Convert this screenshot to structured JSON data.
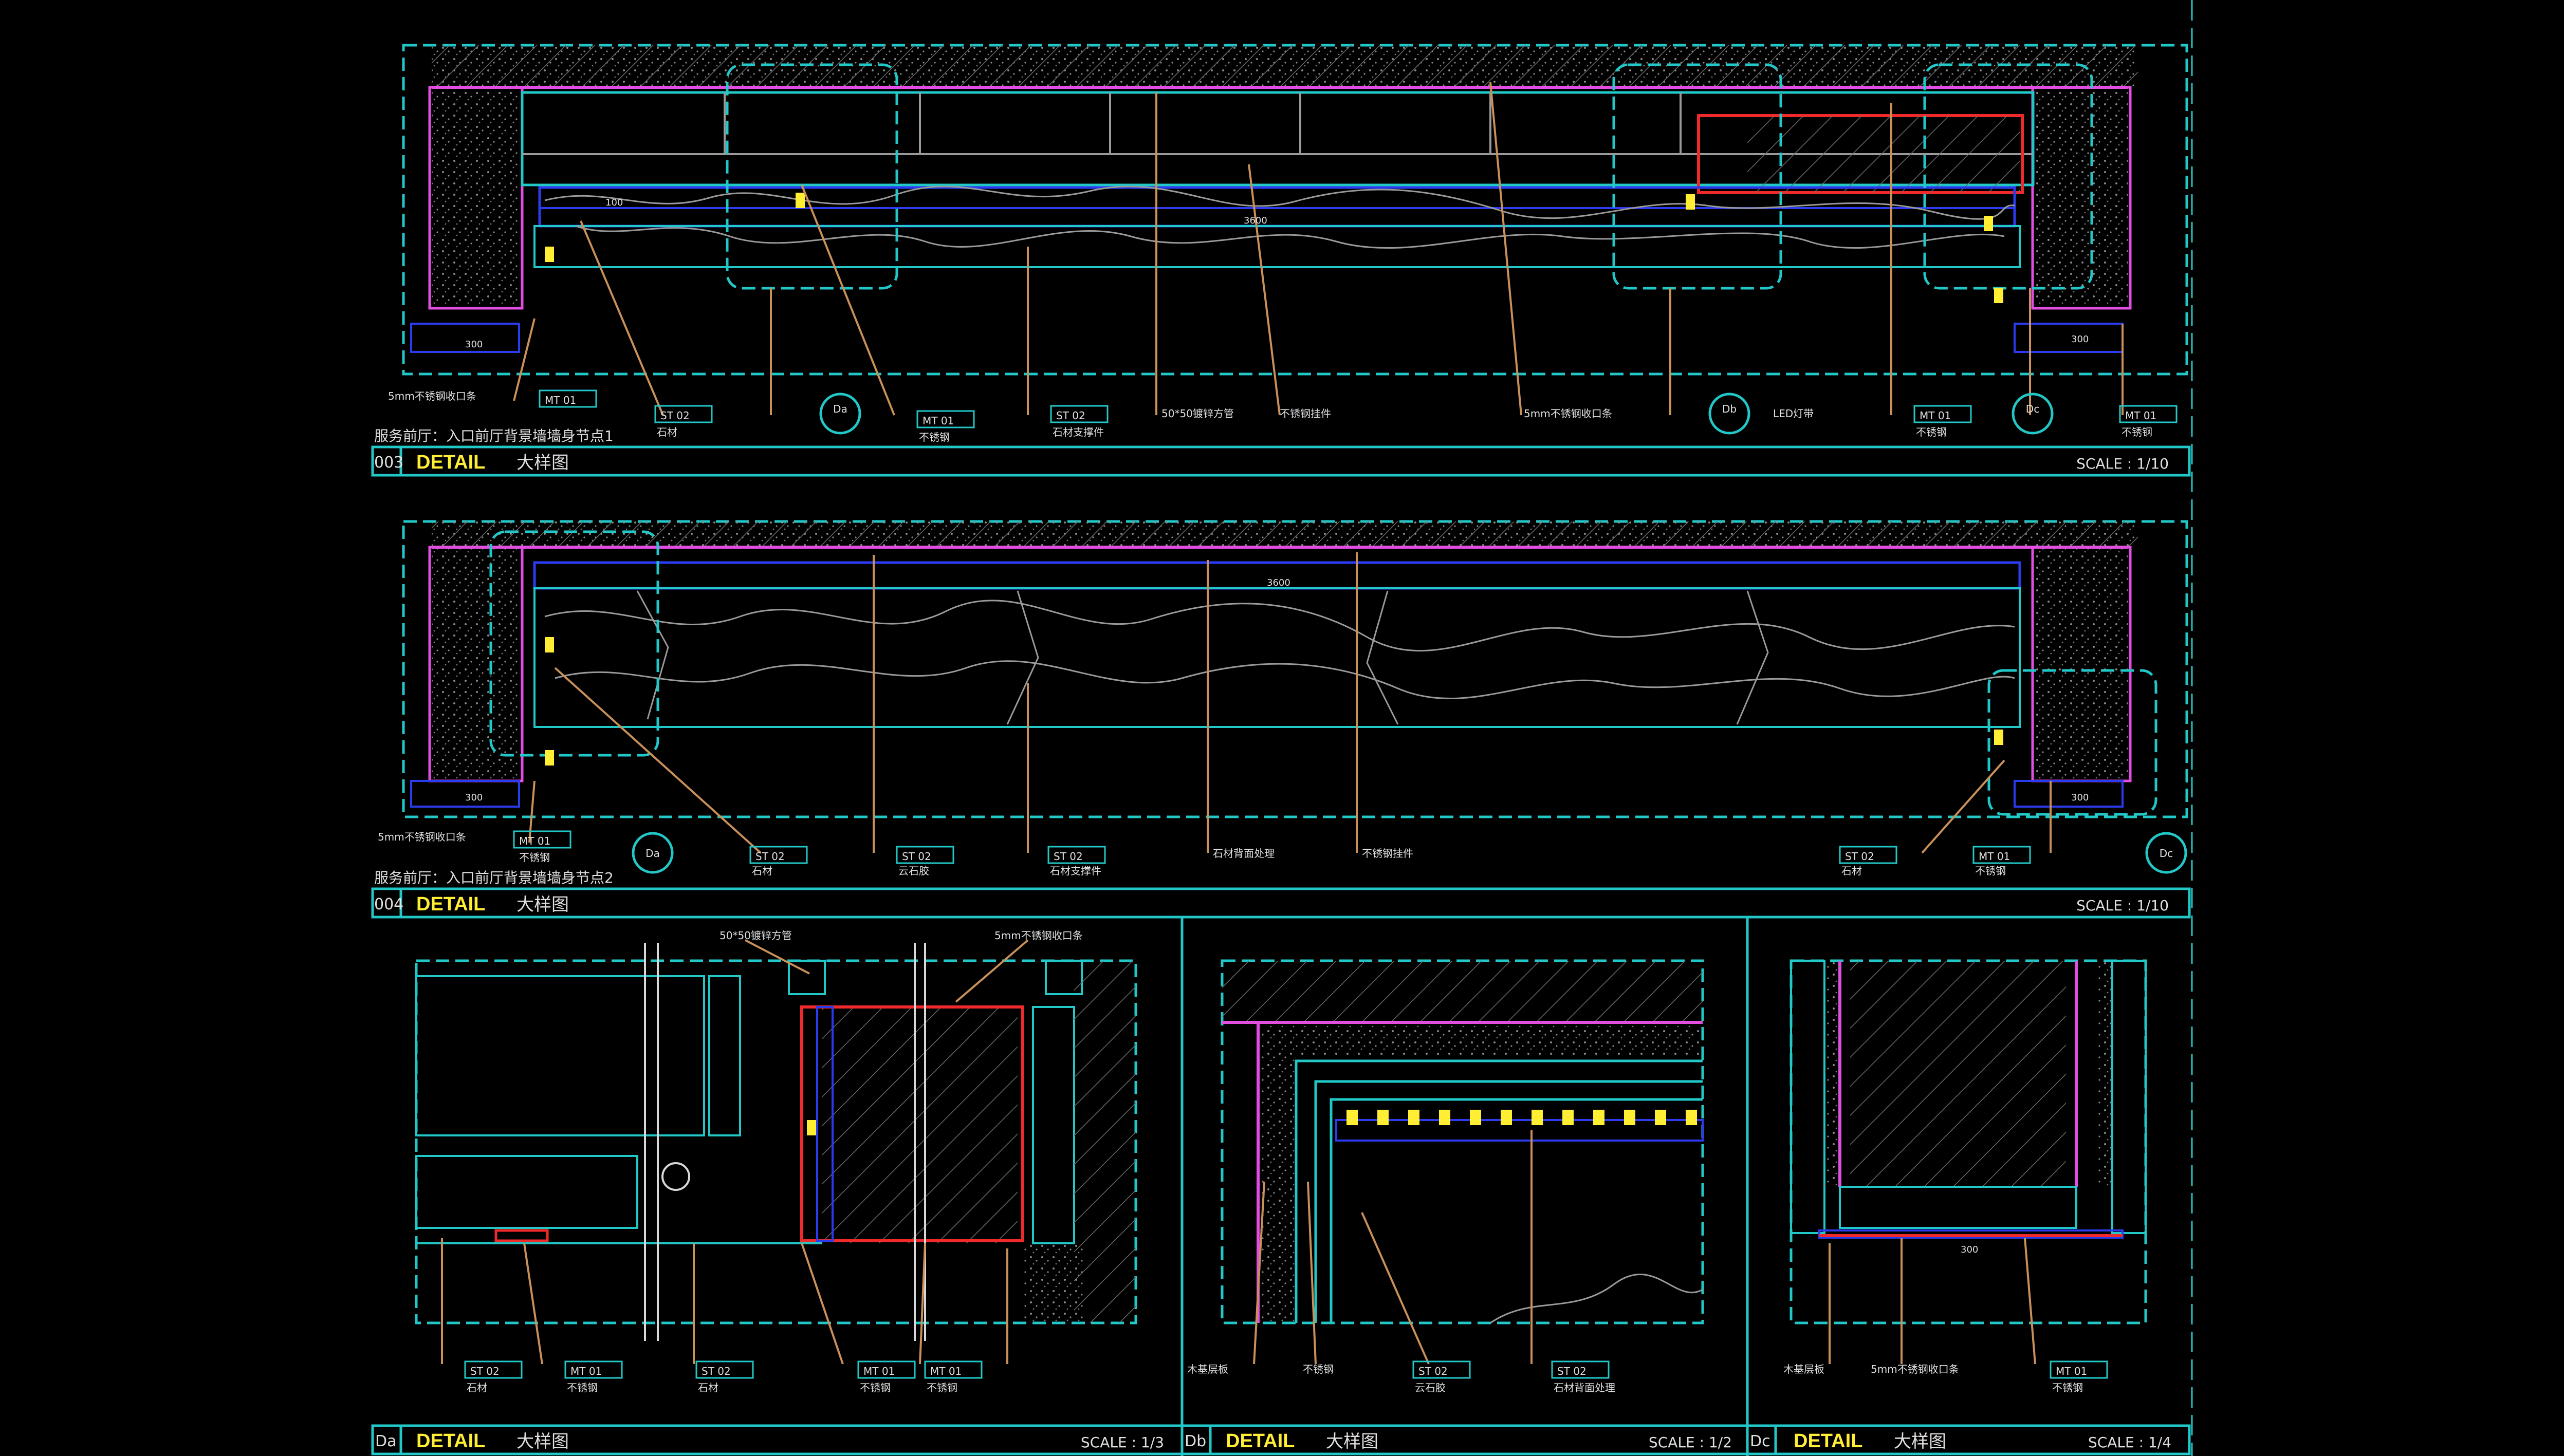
{
  "detail_word": "DETAIL",
  "detail_cn": "大样图",
  "panels": [
    {
      "id": "003",
      "scale": "SCALE : 1/10",
      "caption": "服务前厅：入口前厅背景墙墙身节点1"
    },
    {
      "id": "004",
      "scale": "SCALE : 1/10",
      "caption": "服务前厅：入口前厅背景墙墙身节点2"
    },
    {
      "id": "Da",
      "scale": "SCALE : 1/3",
      "caption": ""
    },
    {
      "id": "Db",
      "scale": "SCALE : 1/2",
      "caption": ""
    },
    {
      "id": "Dc",
      "scale": "SCALE : 1/4",
      "caption": ""
    }
  ],
  "tags": {
    "st02": "ST 02",
    "mt01": "MT 01"
  },
  "callouts": {
    "da": "Da",
    "db": "Db",
    "dc": "Dc"
  },
  "notes": {
    "stone": "石材",
    "steel": "不锈钢",
    "stone_support": "石材支撑件",
    "glue": "云石胶",
    "channel": "5mm不锈钢收口条",
    "pipe": "50*50镀锌方管",
    "back": "石材背面处理",
    "bolt": "不锈钢挂件",
    "light": "LED灯带",
    "board": "木基层板"
  },
  "dims": {
    "d1": "300",
    "d2": "3600",
    "d3": "100"
  }
}
